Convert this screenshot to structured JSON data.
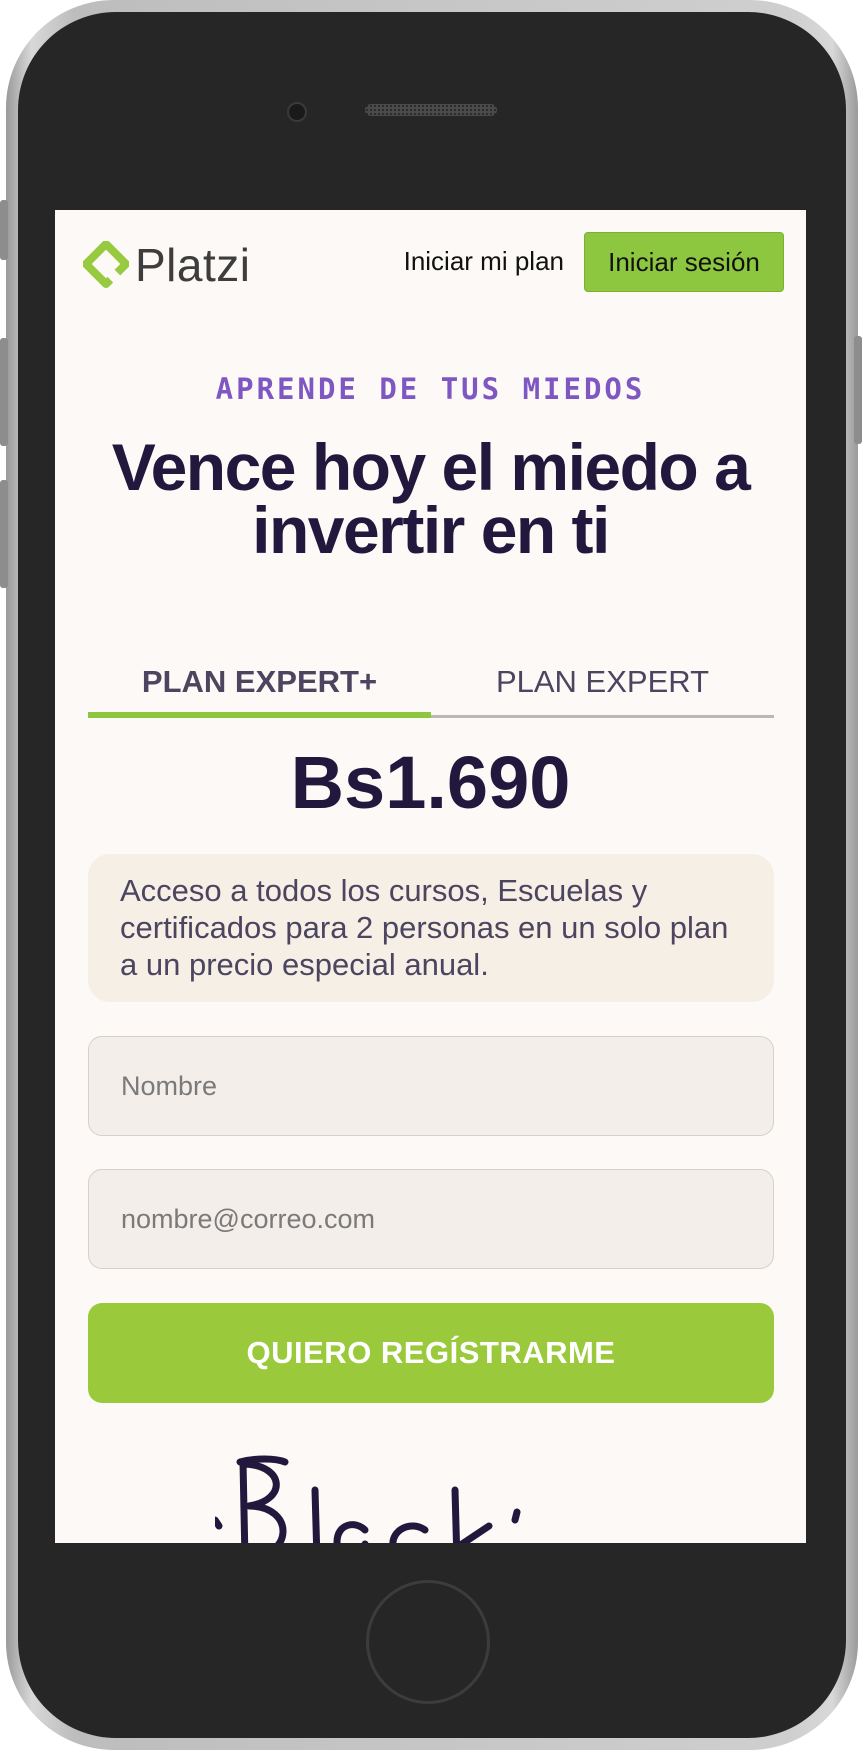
{
  "header": {
    "logo_text": "Platzi",
    "nav_link": "Iniciar mi plan",
    "login_button": "Iniciar sesión"
  },
  "hero": {
    "eyebrow": "APRENDE DE TUS MIEDOS",
    "title": "Vence hoy el miedo a invertir en ti"
  },
  "plans": {
    "tabs": [
      {
        "label": "PLAN EXPERT+",
        "active": true
      },
      {
        "label": "PLAN EXPERT",
        "active": false
      }
    ],
    "price": "Bs1.690",
    "description": "Acceso a todos los cursos, Escuelas y certificados para 2 personas en un solo plan a un precio especial anual."
  },
  "form": {
    "name_placeholder": "Nombre",
    "email_placeholder": "nombre@correo.com",
    "submit_label": "QUIERO REGÍSTRARME"
  },
  "footer_art": {
    "text": "Black"
  },
  "colors": {
    "brand_green": "#98CA3F",
    "heading": "#22173D",
    "eyebrow": "#7E57C2",
    "screen_bg": "#FCF9F6"
  },
  "icons": {
    "logo": "platzi-logo-icon"
  }
}
